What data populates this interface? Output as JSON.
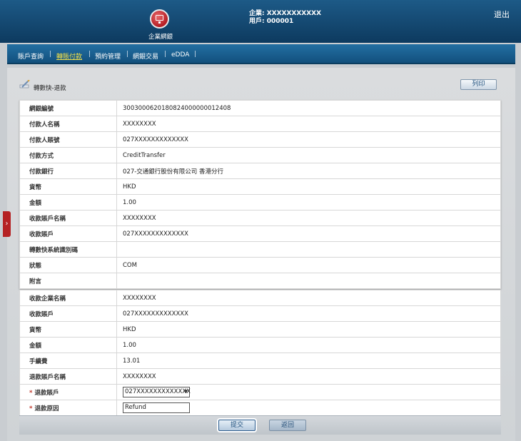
{
  "header": {
    "logo_label": "企業網銀",
    "company_line": "企業: XXXXXXXXXXX",
    "user_line": "用戶: 000001",
    "logout": "退出"
  },
  "nav": {
    "items": [
      "賬戶查詢",
      "轉賬付款",
      "預約管理",
      "網銀交易",
      "eDDA"
    ],
    "active_index": 1
  },
  "page": {
    "title": "轉數快-退款",
    "print_button": "列印"
  },
  "details": [
    {
      "label": "網銀編號",
      "value": "3003000620180824000000012408"
    },
    {
      "label": "付款人名稱",
      "value": "XXXXXXXX"
    },
    {
      "label": "付款人賬號",
      "value": "027XXXXXXXXXXXXX"
    },
    {
      "label": "付款方式",
      "value": "CreditTransfer"
    },
    {
      "label": "付款銀行",
      "value": "027-交通銀行股份有限公司 香港分行"
    },
    {
      "label": "貨幣",
      "value": "HKD"
    },
    {
      "label": "金額",
      "value": "1.00"
    },
    {
      "label": "收款賬戶名稱",
      "value": "XXXXXXXX"
    },
    {
      "label": "收款賬戶",
      "value": "027XXXXXXXXXXXXX"
    },
    {
      "label": "轉數快系統識別碼",
      "value": ""
    },
    {
      "label": "狀態",
      "value": "COM"
    },
    {
      "label": "附言",
      "value": ""
    }
  ],
  "refund": [
    {
      "label": "收款企業名稱",
      "value": "XXXXXXXX"
    },
    {
      "label": "收款賬戶",
      "value": "027XXXXXXXXXXXXX"
    },
    {
      "label": "貨幣",
      "value": "HKD"
    },
    {
      "label": "金額",
      "value": "1.00"
    },
    {
      "label": "手續費",
      "value": "13.01"
    },
    {
      "label": "退款賬戶名稱",
      "value": "XXXXXXXX"
    }
  ],
  "form": {
    "refund_account_label": "退款賬戶",
    "refund_account_value": "027XXXXXXXXXXXXX",
    "refund_reason_label": "退款原因",
    "refund_reason_value": "Refund",
    "required_mark": "*"
  },
  "footer": {
    "submit": "提交",
    "back": "返回"
  },
  "side_tab_glyph": "›",
  "colors": {
    "header": "#0d3a5f",
    "nav_active": "#f3e14a",
    "logo": "#b51d24",
    "side_tab": "#b52224"
  }
}
